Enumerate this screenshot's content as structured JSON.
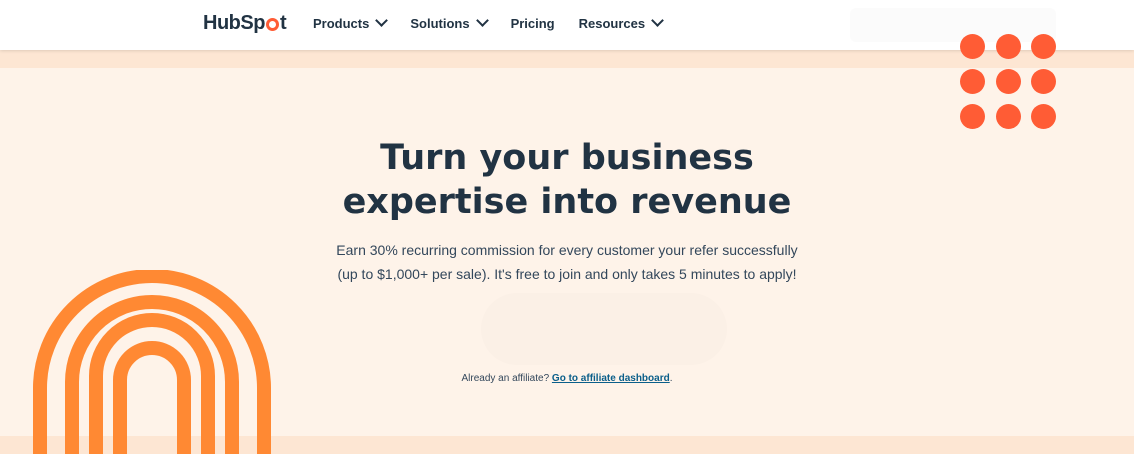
{
  "header": {
    "logo_text_1": "HubSp",
    "logo_text_2": "t",
    "nav": [
      {
        "label": "Products",
        "has_dropdown": true
      },
      {
        "label": "Solutions",
        "has_dropdown": true
      },
      {
        "label": "Pricing",
        "has_dropdown": false
      },
      {
        "label": "Resources",
        "has_dropdown": true
      }
    ]
  },
  "hero": {
    "headline_line1": "Turn your business",
    "headline_line2": "expertise into revenue",
    "sub_line1": "Earn 30% recurring commission for every customer your refer successfully",
    "sub_line2": "(up to $1,000+ per sale). It's free to join and only takes 5 minutes to apply!",
    "affiliate_prompt": "Already an affiliate?",
    "affiliate_link": "Go to affiliate dashboard",
    "affiliate_suffix": "."
  },
  "colors": {
    "brand_orange": "#ff5c35",
    "arch_orange": "#ff8933",
    "text_dark": "#213343",
    "link_blue": "#0b5f8a",
    "hero_bg": "#fef3e9"
  }
}
